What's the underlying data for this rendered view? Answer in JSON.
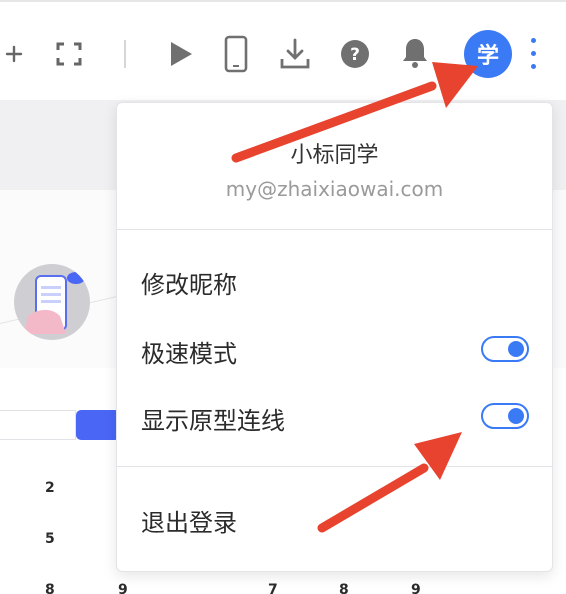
{
  "toolbar": {
    "add_icon": "plus-icon",
    "fullscreen_icon": "fullscreen-icon",
    "play_icon": "play-icon",
    "device_icon": "mobile-device-icon",
    "download_icon": "download-icon",
    "help_icon": "help-icon",
    "notification_icon": "bell-icon",
    "avatar_label": "学",
    "more_icon": "more-vertical-icon"
  },
  "user_menu": {
    "name": "小标同学",
    "email": "my@zhaixiaowai.com",
    "items": [
      {
        "label": "修改昵称"
      },
      {
        "label": "极速模式",
        "toggle_on": true
      },
      {
        "label": "显示原型连线",
        "toggle_on": true
      }
    ],
    "logout_label": "退出登录"
  },
  "canvas": {
    "cells": [
      "2",
      "5",
      "8",
      "9",
      "7",
      "8",
      "9"
    ]
  },
  "colors": {
    "accent": "#3a7af5",
    "arrow": "#e8432e",
    "button": "#4a66f5"
  }
}
